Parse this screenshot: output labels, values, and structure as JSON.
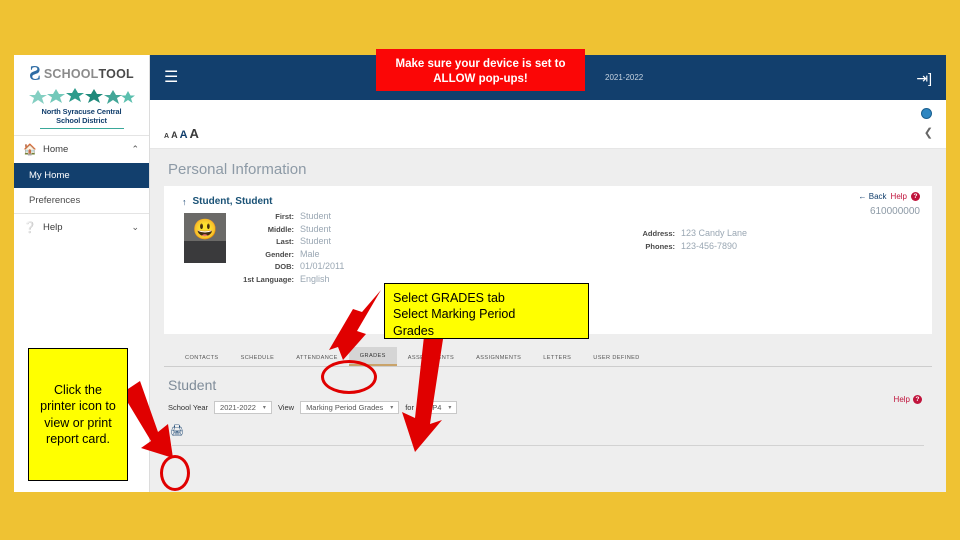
{
  "theme": {
    "page_bg": "#efc233",
    "header_navy": "#123f6d",
    "annotation_red": "#fb0606",
    "annotation_yellow": "#ffff00",
    "accent_teal": "#3aa89a",
    "help_red": "#c0143c"
  },
  "sidebar": {
    "logo": {
      "mark": "Ƨ",
      "text_light": "SCHOOL",
      "text_bold": "TOOL"
    },
    "district": {
      "line1": "North Syracuse Central",
      "line2": "School District"
    },
    "nav": {
      "home_label": "Home",
      "home_icon": "home-icon",
      "home_chevron": "⌃",
      "items": [
        {
          "label": "My Home",
          "active": true
        },
        {
          "label": "Preferences",
          "active": false
        }
      ],
      "help_label": "Help",
      "help_icon": "question-circle-icon",
      "help_chevron": "⌄"
    }
  },
  "topbar": {
    "menu_icon": "hamburger-icon",
    "school_year": "2021-2022",
    "logout_icon": "logout-icon"
  },
  "subbar": {
    "font_sizes": [
      "A",
      "A",
      "A",
      "A"
    ],
    "globe_icon": "globe-icon",
    "collapse_icon": "chevron-up-icon"
  },
  "personal_information": {
    "title": "Personal Information",
    "back_label": "Back",
    "back_arrow": "←",
    "help_label": "Help",
    "help_badge": "?",
    "student_id": "610000000",
    "student_name": "Student, Student",
    "name_arrow": "↑",
    "fields": [
      {
        "label": "First:",
        "value": "Student"
      },
      {
        "label": "Middle:",
        "value": "Student"
      },
      {
        "label": "Last:",
        "value": "Student"
      },
      {
        "label": "Gender:",
        "value": "Male"
      },
      {
        "label": "DOB:",
        "value": "01/01/2011"
      },
      {
        "label": "1st Language:",
        "value": "English"
      }
    ],
    "contact": [
      {
        "label": "Address:",
        "value": "123 Candy Lane"
      },
      {
        "label": "Phones:",
        "value": "123-456-7890"
      }
    ]
  },
  "tabs": [
    {
      "label": "CONTACTS",
      "active": false
    },
    {
      "label": "SCHEDULE",
      "active": false
    },
    {
      "label": "ATTENDANCE",
      "active": false
    },
    {
      "label": "GRADES",
      "active": true
    },
    {
      "label": "ASSESSMENTS",
      "active": false
    },
    {
      "label": "ASSIGNMENTS",
      "active": false
    },
    {
      "label": "LETTERS",
      "active": false
    },
    {
      "label": "USER DEFINED",
      "active": false
    }
  ],
  "grades_panel": {
    "title": "Student",
    "school_year_label": "School Year",
    "school_year_value": "2021-2022",
    "view_label": "View",
    "view_value": "Marking Period Grades",
    "for_label": "for",
    "mp_value": "MP4",
    "caret": "▾",
    "printer_icon": "printer-icon",
    "help_label": "Help",
    "help_badge": "?"
  },
  "annotations": {
    "popups": "Make sure your device is set to ALLOW pop-ups!",
    "grades": "Select GRADES tab\nSelect Marking Period Grades",
    "printer": "Click the printer icon to view or print report card."
  }
}
